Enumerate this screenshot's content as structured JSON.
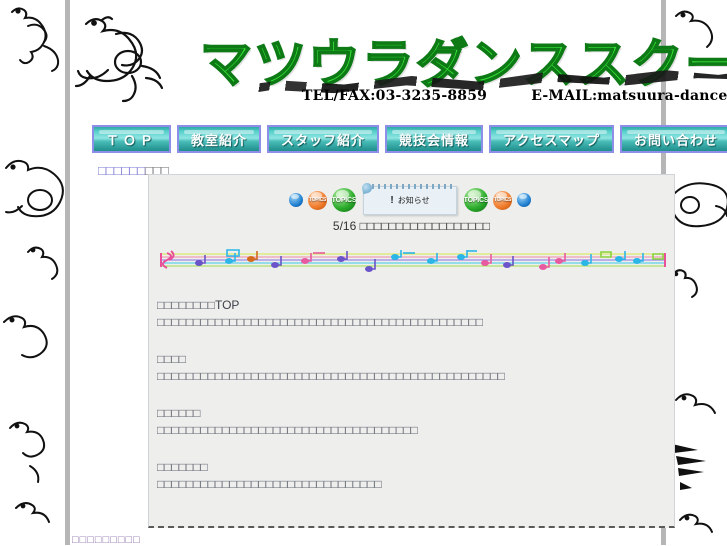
{
  "site": {
    "logo_text": "マツウラダンススクール",
    "tel_label": "TEL/FAX:03-3235-8859",
    "email_label": "E-MAIL:matsuura-danceschool@nifty.com",
    "mascot_icon": "elephant-doodle-icon",
    "brand_green": "#39e639",
    "brand_teal": "#2fa9a4",
    "nav_border": "#8d8ee8"
  },
  "nav": {
    "items": [
      {
        "label": "ＴＯＰ",
        "name": "nav-top",
        "wide": true
      },
      {
        "label": "教室紹介",
        "name": "nav-classroom"
      },
      {
        "label": "スタッフ紹介",
        "name": "nav-staff"
      },
      {
        "label": "競技会情報",
        "name": "nav-competition"
      },
      {
        "label": "アクセスマップ",
        "name": "nav-access-map"
      },
      {
        "label": "お問い合わせ",
        "name": "nav-contact"
      }
    ]
  },
  "breadcrumb": {
    "text": "□□□□□□",
    "suffix": "□□□"
  },
  "topics": {
    "orbs": [
      {
        "icon": "topics-orb-blue-small",
        "label": "",
        "size": "blue"
      },
      {
        "icon": "topics-orb-orange",
        "label": "TOPICS",
        "size": "orange"
      },
      {
        "icon": "topics-orb-green",
        "label": "TOPICS",
        "size": "green"
      }
    ],
    "orbs_right": [
      {
        "icon": "topics-orb-green",
        "label": "TOPICS",
        "size": "green"
      },
      {
        "icon": "topics-orb-orange",
        "label": "TOPICS",
        "size": "orange"
      },
      {
        "icon": "topics-orb-blue-small",
        "label": "",
        "size": "blue"
      }
    ],
    "note_card": {
      "icon": "notice-memo-icon",
      "bang": "!",
      "label": "お知らせ"
    }
  },
  "notice": {
    "date": "5/16",
    "text": "□□□□□□□□□□□□□□□□□□"
  },
  "divider": {
    "icon": "music-staff-divider-icon"
  },
  "content_blocks": [
    {
      "heading_boxes": "□□□□□□□□",
      "heading_latin": "TOP",
      "body": "□□□□□□□□□□□□□□□□□□□□□□□□□□□□□□□□□□□□□□□□□□□□□"
    },
    {
      "heading_boxes": "□□□□",
      "heading_latin": "",
      "body": "□□□□□□□□□□□□□□□□□□□□□□□□□□□□□□□□□□□□□□□□□□□□□□□□"
    },
    {
      "heading_boxes": "□□□□□□",
      "heading_latin": "",
      "body": "□□□□□□□□□□□□□□□□□□□□□□□□□□□□□□□□□□□□"
    },
    {
      "heading_boxes": "□□□□□□□",
      "heading_latin": "",
      "body": "□□□□□□□□□□□□□□□□□□□□□□□□□□□□□□□"
    }
  ],
  "footer": {
    "text": "□□□□□□□□□"
  }
}
